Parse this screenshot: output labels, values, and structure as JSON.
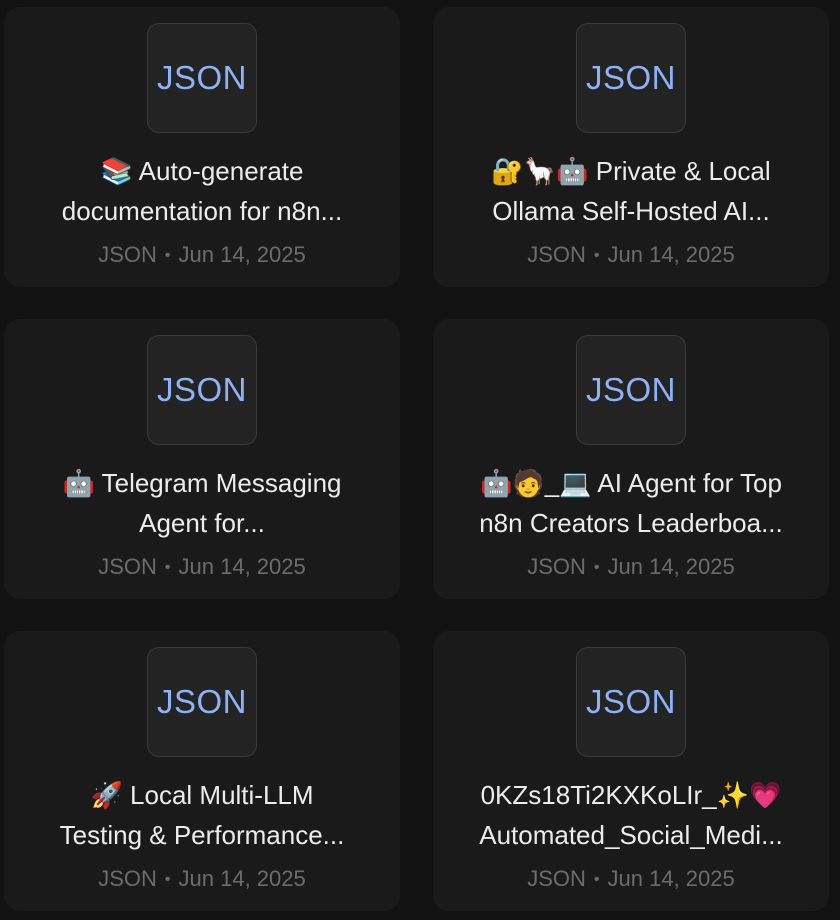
{
  "cards": [
    {
      "thumb_label": "JSON",
      "title_line1": "📚 Auto-generate",
      "title_line2": "documentation for n8n...",
      "type": "JSON",
      "separator": "•",
      "date": "Jun 14, 2025"
    },
    {
      "thumb_label": "JSON",
      "title_line1": "🔐🦙🤖 Private & Local",
      "title_line2": "Ollama Self-Hosted AI...",
      "type": "JSON",
      "separator": "•",
      "date": "Jun 14, 2025"
    },
    {
      "thumb_label": "JSON",
      "title_line1": "🤖 Telegram Messaging",
      "title_line2": "Agent for...",
      "type": "JSON",
      "separator": "•",
      "date": "Jun 14, 2025"
    },
    {
      "thumb_label": "JSON",
      "title_line1": "🤖🧑_💻 AI Agent for Top",
      "title_line2": "n8n Creators Leaderboa...",
      "type": "JSON",
      "separator": "•",
      "date": "Jun 14, 2025"
    },
    {
      "thumb_label": "JSON",
      "title_line1": "🚀 Local Multi-LLM",
      "title_line2": "Testing & Performance...",
      "type": "JSON",
      "separator": "•",
      "date": "Jun 14, 2025"
    },
    {
      "thumb_label": "JSON",
      "title_line1": "0KZs18Ti2KXKoLIr_✨💗",
      "title_line2": "Automated_Social_Medi...",
      "type": "JSON",
      "separator": "•",
      "date": "Jun 14, 2025"
    }
  ]
}
